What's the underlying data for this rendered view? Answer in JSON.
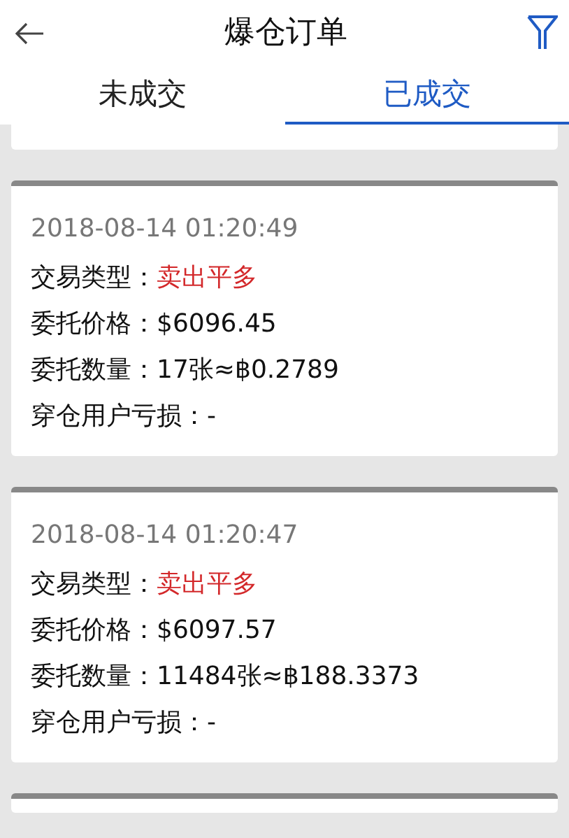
{
  "header": {
    "title": "爆仓订单"
  },
  "tabs": [
    {
      "label": "未成交",
      "selected": false
    },
    {
      "label": "已成交",
      "selected": true
    }
  ],
  "orders": [
    {
      "time": "2018-08-14 01:20:49",
      "rows": [
        {
          "label": "交易类型：",
          "value": "卖出平多",
          "kind": "sell"
        },
        {
          "label": "委托价格：",
          "value": "$6096.45",
          "kind": "plain"
        },
        {
          "label": "委托数量：",
          "value": "17张≈฿0.2789",
          "kind": "plain"
        },
        {
          "label": "穿仓用户亏损：",
          "value": "-",
          "kind": "plain"
        }
      ]
    },
    {
      "time": "2018-08-14 01:20:47",
      "rows": [
        {
          "label": "交易类型：",
          "value": "卖出平多",
          "kind": "sell"
        },
        {
          "label": "委托价格：",
          "value": "$6097.57",
          "kind": "plain"
        },
        {
          "label": "委托数量：",
          "value": "11484张≈฿188.3373",
          "kind": "plain"
        },
        {
          "label": "穿仓用户亏损：",
          "value": "-",
          "kind": "plain"
        }
      ]
    }
  ]
}
